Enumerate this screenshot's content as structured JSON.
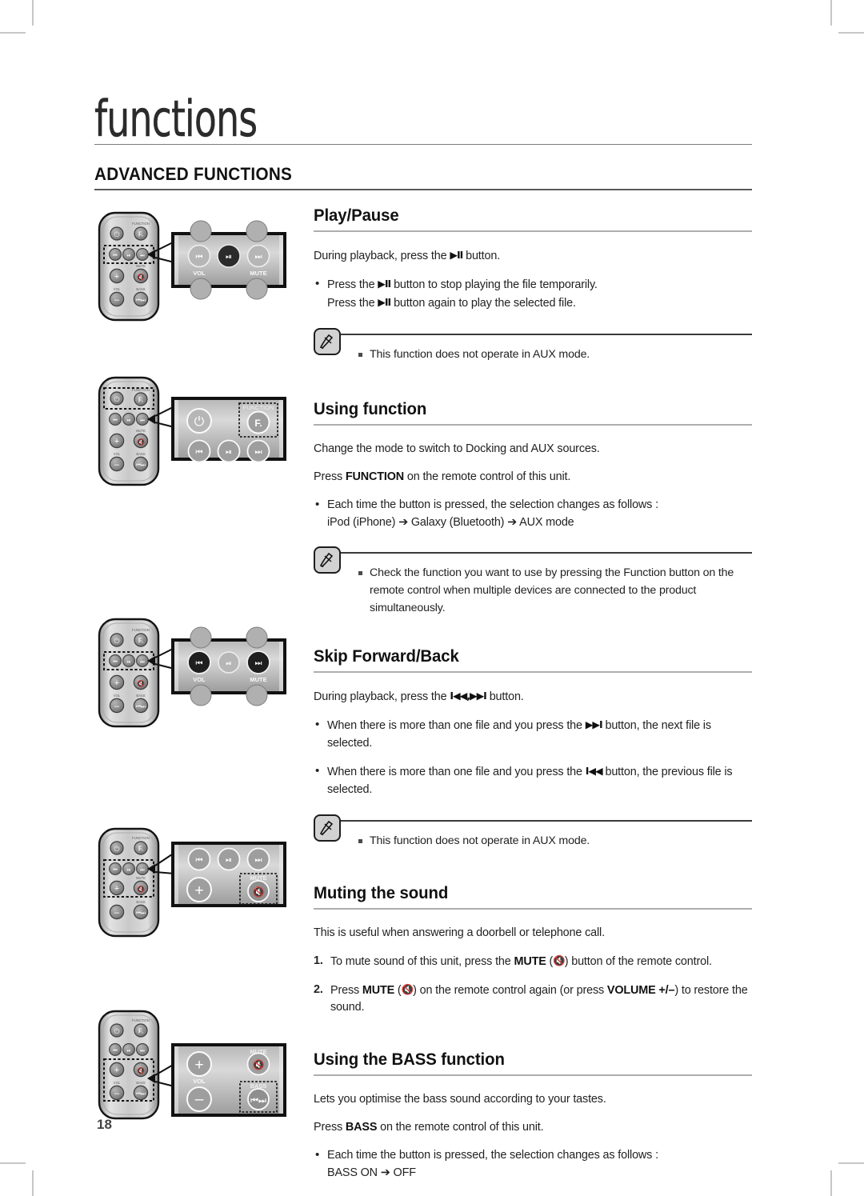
{
  "page": {
    "chapter_title": "functions",
    "section_title": "ADVANCED FUNCTIONS",
    "folio": "18"
  },
  "sections": [
    {
      "id": "play-pause",
      "heading": "Play/Pause",
      "intro": "During playback, press the ▶Ⅱ button.",
      "intro_pre": "During playback, press the ",
      "intro_glyph": "▶II",
      "intro_post": " button.",
      "bullets": [
        {
          "pre": "Press the ",
          "glyph": "▶II",
          "mid": " button to stop playing the file temporarily.",
          "line2_pre": "Press the ",
          "line2_glyph": "▶II",
          "line2_post": " button again to play the selected file."
        }
      ],
      "note": [
        "This function does not operate in AUX mode."
      ]
    },
    {
      "id": "using-function",
      "heading": "Using function",
      "para1": "Change the mode to switch to Docking and AUX sources.",
      "para2_pre": "Press ",
      "para2_bold": "FUNCTION",
      "para2_post": " on the remote control of this unit.",
      "bullet_line1": "Each time the button is pressed, the selection changes as follows :",
      "bullet_line2": "iPod (iPhone) ➔ Galaxy (Bluetooth) ➔ AUX mode",
      "bullet_chain": [
        "iPod (iPhone)",
        "Galaxy (Bluetooth)",
        "AUX mode"
      ],
      "note": [
        "Check the function you want to use by pressing the Function button on the remote control when multiple devices are connected to the product simultaneously."
      ]
    },
    {
      "id": "skip-forward-back",
      "heading": "Skip Forward/Back",
      "intro_pre": "During playback, press the ",
      "intro_glyph": "I◀◀,▶▶I",
      "intro_post": " button.",
      "bullet1_pre": "When there is more than one file and you press the ",
      "bullet1_glyph": "▶▶I",
      "bullet1_post": " button, the next file is selected.",
      "bullet2_pre": "When there is more than one file and you press the ",
      "bullet2_glyph": "I◀◀",
      "bullet2_post": " button, the previous file is selected.",
      "note": [
        "This function does not operate in AUX mode."
      ]
    },
    {
      "id": "muting-the-sound",
      "heading": "Muting the sound",
      "intro": "This is useful when answering a doorbell or telephone call.",
      "steps": [
        {
          "num": "1.",
          "pre": "To mute sound of this unit, press the ",
          "bold": "MUTE",
          "mid": " (",
          "icon": "mute-icon",
          "post": ") button of the remote control."
        },
        {
          "num": "2.",
          "pre": "Press ",
          "bold": "MUTE",
          "mid": " (",
          "icon": "mute-icon",
          "post": ") on the remote control again (or press ",
          "bold2": "VOLUME +/–",
          "tail": ") to restore the sound."
        }
      ]
    },
    {
      "id": "using-the-bass-function",
      "heading": "Using the BASS function",
      "para1": "Lets you optimise the bass sound according to your tastes.",
      "para2_pre": "Press ",
      "para2_bold": "BASS",
      "para2_post": " on the remote control of this unit.",
      "bullet_line1": "Each time the button is pressed, the selection changes as follows :",
      "bullet_line2": "BASS ON ➔ OFF",
      "bullet_chain": [
        "BASS ON",
        "OFF"
      ]
    }
  ],
  "remote": {
    "labels": {
      "function": "FUNCTION",
      "mute": "MUTE",
      "bass": "BASS",
      "vol": "VOL"
    },
    "buttons": [
      {
        "name": "power-button",
        "icon": "power-icon"
      },
      {
        "name": "function-button",
        "icon": "function-icon"
      },
      {
        "name": "skip-back-button",
        "icon": "skip-back-icon"
      },
      {
        "name": "play-pause-button",
        "icon": "play-pause-icon"
      },
      {
        "name": "skip-forward-button",
        "icon": "skip-forward-icon"
      },
      {
        "name": "volume-up-button",
        "icon": "plus-icon"
      },
      {
        "name": "mute-button",
        "icon": "mute-icon"
      },
      {
        "name": "volume-down-button",
        "icon": "minus-icon"
      },
      {
        "name": "bass-button",
        "icon": "bass-icon"
      }
    ]
  },
  "figures": [
    {
      "id": "fig-play-pause",
      "highlight_row": "transport",
      "callout_labels": [
        "VOL",
        "MUTE"
      ]
    },
    {
      "id": "fig-using-function",
      "highlight_row": "top",
      "callout_labels": [
        "FUNCTION"
      ]
    },
    {
      "id": "fig-skip",
      "highlight_row": "transport",
      "callout_labels": [
        "VOL",
        "MUTE"
      ]
    },
    {
      "id": "fig-mute",
      "highlight_row": "mute",
      "callout_labels": [
        "MUTE"
      ]
    },
    {
      "id": "fig-bass",
      "highlight_row": "bass",
      "callout_labels": [
        "MUTE",
        "VOL",
        "BASS"
      ]
    }
  ],
  "colors": {
    "rule": "#aeaeae",
    "heading": "#111111",
    "body": "#222222",
    "note_icon_fill": "#d2d2d2",
    "remote_body_light": "#d8d8d8",
    "remote_body_dark": "#8e8e8e"
  }
}
